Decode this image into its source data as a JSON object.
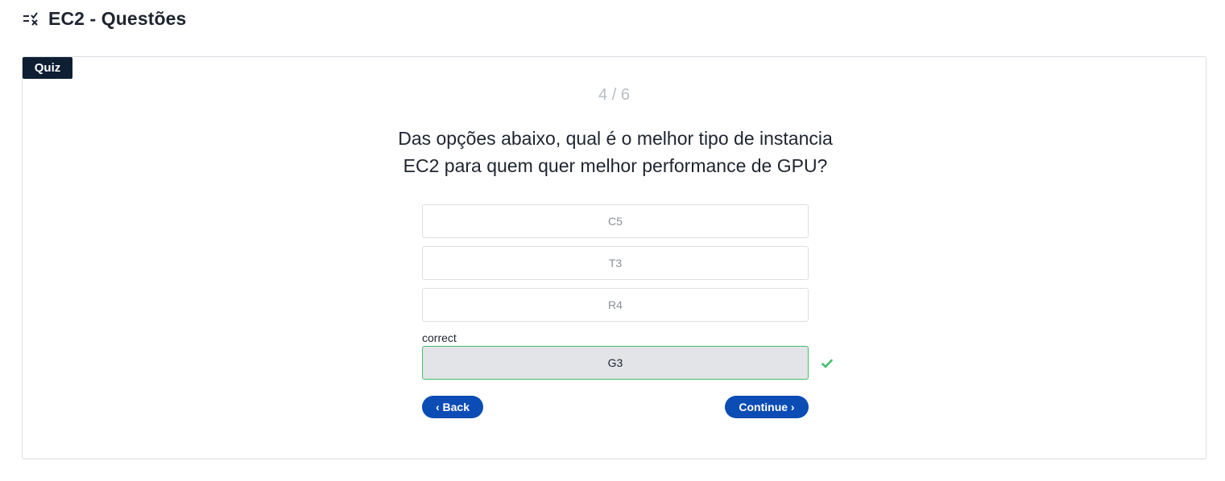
{
  "header": {
    "title": "EC2 - Questões",
    "icon": "checklist-icon"
  },
  "quiz": {
    "badge": "Quiz",
    "progress": "4 / 6",
    "question_line1": "Das opções abaixo, qual é o melhor tipo de instancia",
    "question_line2": "EC2 para quem quer melhor performance de GPU?",
    "options": [
      {
        "label": "C5",
        "state": "default"
      },
      {
        "label": "T3",
        "state": "default"
      },
      {
        "label": "R4",
        "state": "default"
      },
      {
        "label": "G3",
        "state": "correct"
      }
    ],
    "correct_label": "correct",
    "back_label": "‹ Back",
    "continue_label": "Continue ›"
  },
  "colors": {
    "accent": "#0b4cb5",
    "badge": "#0e1e33",
    "correct": "#3fbf6a"
  }
}
